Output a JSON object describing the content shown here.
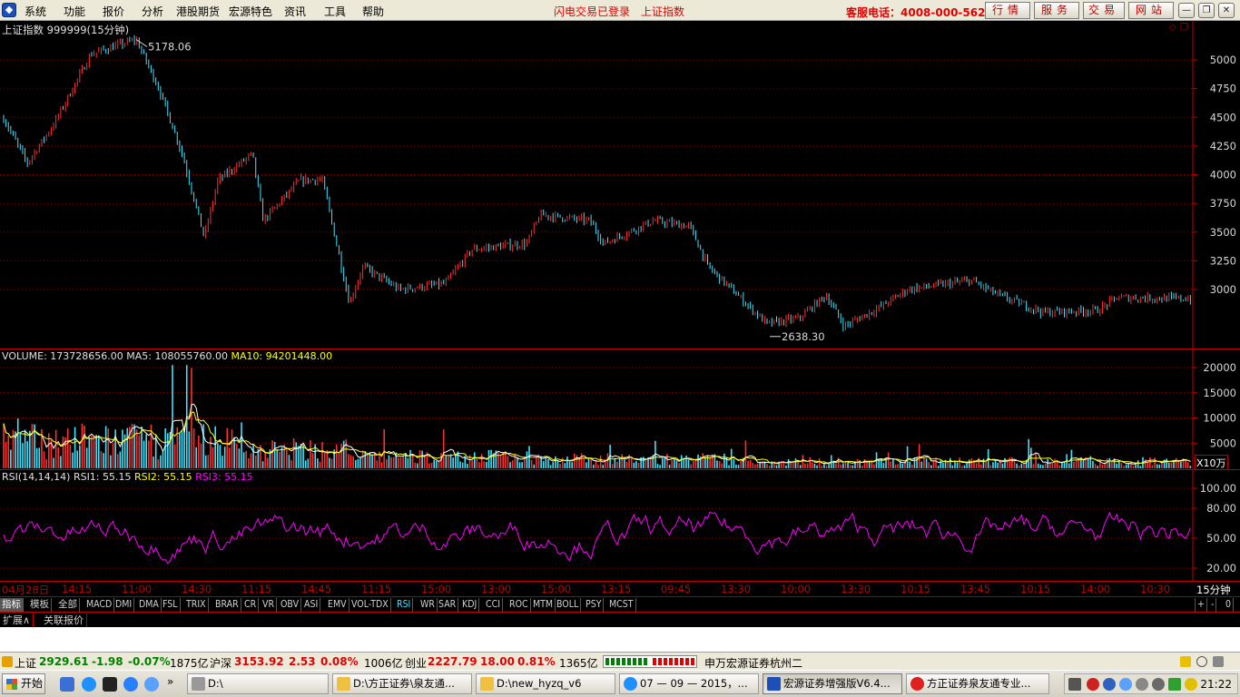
{
  "menubar": {
    "items": [
      "系统",
      "功能",
      "报价",
      "分析",
      "港股期货",
      "宏源特色",
      "资讯",
      "工具",
      "帮助"
    ],
    "status_login": "闪电交易已登录",
    "status_index": "上证指数",
    "hotline": "客服电话：4008-000-562",
    "buttons": [
      "行情",
      "服务",
      "交易",
      "网站"
    ],
    "window_buttons": [
      "minimize",
      "restore",
      "close"
    ]
  },
  "price_panel": {
    "title": "上证指数 999999(15分钟)",
    "high_label": "5178.06",
    "low_label": "2638.30",
    "y_ticks": [
      "5000",
      "4750",
      "4500",
      "4250",
      "4000",
      "3750",
      "3500",
      "3250",
      "3000"
    ],
    "corner_icons": [
      "diamond-icon",
      "window-icon"
    ]
  },
  "volume_panel": {
    "label_volume": "VOLUME: 173728656.00",
    "label_ma5": "MA5: 108055760.00",
    "label_ma10": "MA10: 94201448.00",
    "y_ticks": [
      "20000",
      "15000",
      "10000",
      "5000"
    ],
    "unit": "X10万"
  },
  "rsi_panel": {
    "label_params": "RSI(14,14,14)",
    "label_rsi1": "RSI1: 55.15",
    "label_rsi2": "RSI2: 55.15",
    "label_rsi3": "RSI3: 55.15",
    "y_ticks": [
      "100.00",
      "80.00",
      "50.00",
      "20.00"
    ]
  },
  "time_axis": {
    "labels": [
      "04月28日",
      "14:15",
      "11:00",
      "14:30",
      "11:15",
      "14:45",
      "11:15",
      "15:00",
      "13:00",
      "15:00",
      "13:15",
      "09:45",
      "13:30",
      "10:00",
      "13:30",
      "10:15",
      "13:45",
      "10:15",
      "14:00",
      "10:30"
    ],
    "period": "15分钟"
  },
  "indicator_tabs": [
    "指标",
    "模板",
    "全部",
    "MACD",
    "DMI",
    "DMA",
    "FSL",
    "TRIX",
    "BRAR",
    "CR",
    "VR",
    "OBV",
    "ASI",
    "EMV",
    "VOL-TDX",
    "RSI",
    "WR",
    "SAR",
    "KDJ",
    "CCI",
    "ROC",
    "MTM",
    "BOLL",
    "PSY",
    "MCST"
  ],
  "indicator_selected": "RSI",
  "right_controls": [
    "+",
    "-",
    "0"
  ],
  "ext_tabs": [
    "扩展∧",
    "关联报价"
  ],
  "quotebar": {
    "sh_label": "上证",
    "sh_price": "2929.61",
    "sh_change": "-1.98",
    "sh_pct": "-0.07%",
    "sh_amount": "1875亿",
    "hs_label": "沪深",
    "hs_price": "3153.92",
    "hs_change": "2.53",
    "hs_pct": "0.08%",
    "hs_amount": "1006亿",
    "cy_label": "创业",
    "cy_price": "2227.79",
    "cy_change": "18.00",
    "cy_pct": "0.81%",
    "cy_amount": "1365亿",
    "broker": "申万宏源证券杭州二"
  },
  "taskbar": {
    "start": "开始",
    "tasks": [
      "D:\\",
      "D:\\方正证券\\泉友通...",
      "D:\\new_hyzq_v6",
      "07 — 09 — 2015，...",
      "宏源证券增强版V6.4...",
      "方正证券泉友通专业..."
    ],
    "clock": "21:22"
  },
  "colors": {
    "up": "#ff3030",
    "down": "#3fe4ff",
    "ma5": "#ffffff",
    "ma10": "#ffff00",
    "rsi": "#ff00ff",
    "grid": "#8b0000",
    "axis": "#c00000"
  },
  "chart_data": {
    "type": "candlestick",
    "series": [
      {
        "name": "上证指数 999999(15分钟)",
        "high": 5178.06,
        "low": 2638.3
      },
      {
        "name": "VOLUME",
        "last": 173728656.0,
        "ma5": 108055760.0,
        "ma10": 94201448.0
      },
      {
        "name": "RSI(14,14,14)",
        "rsi1": 55.15,
        "rsi2": 55.15,
        "rsi3": 55.15
      }
    ]
  }
}
